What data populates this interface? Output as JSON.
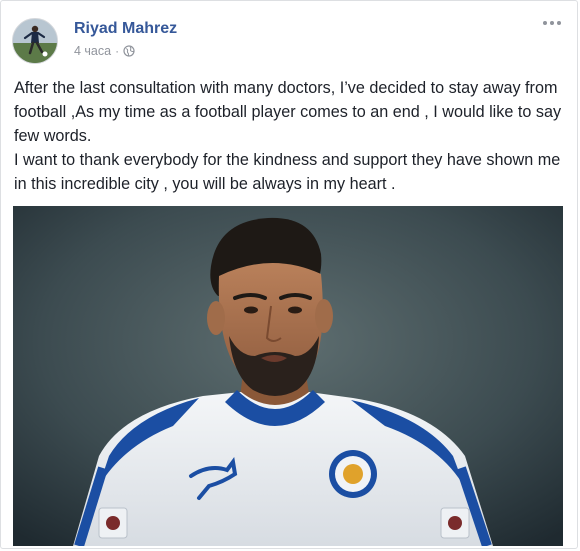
{
  "post": {
    "author": "Riyad Mahrez",
    "timestamp": "4 часа",
    "separator": "·",
    "privacy_icon": "globe-icon",
    "menu_icon": "more-options-icon",
    "paragraphs": [
      "After the last consultation with many doctors, I’ve decided to stay away from football ,As my time as a football player comes to an end , I would like to say few words.",
      "I want to thank everybody for the kindness and support they have shown me in this incredible city , you will be always in my heart ."
    ],
    "photo": {
      "subject": "player-photo",
      "jersey_color": "#ffffff",
      "trim_color": "#1b4ea3"
    }
  },
  "colors": {
    "author_link": "#365899",
    "meta_text": "#90949c",
    "body_text": "#1d2129",
    "border": "#dddfe2"
  }
}
